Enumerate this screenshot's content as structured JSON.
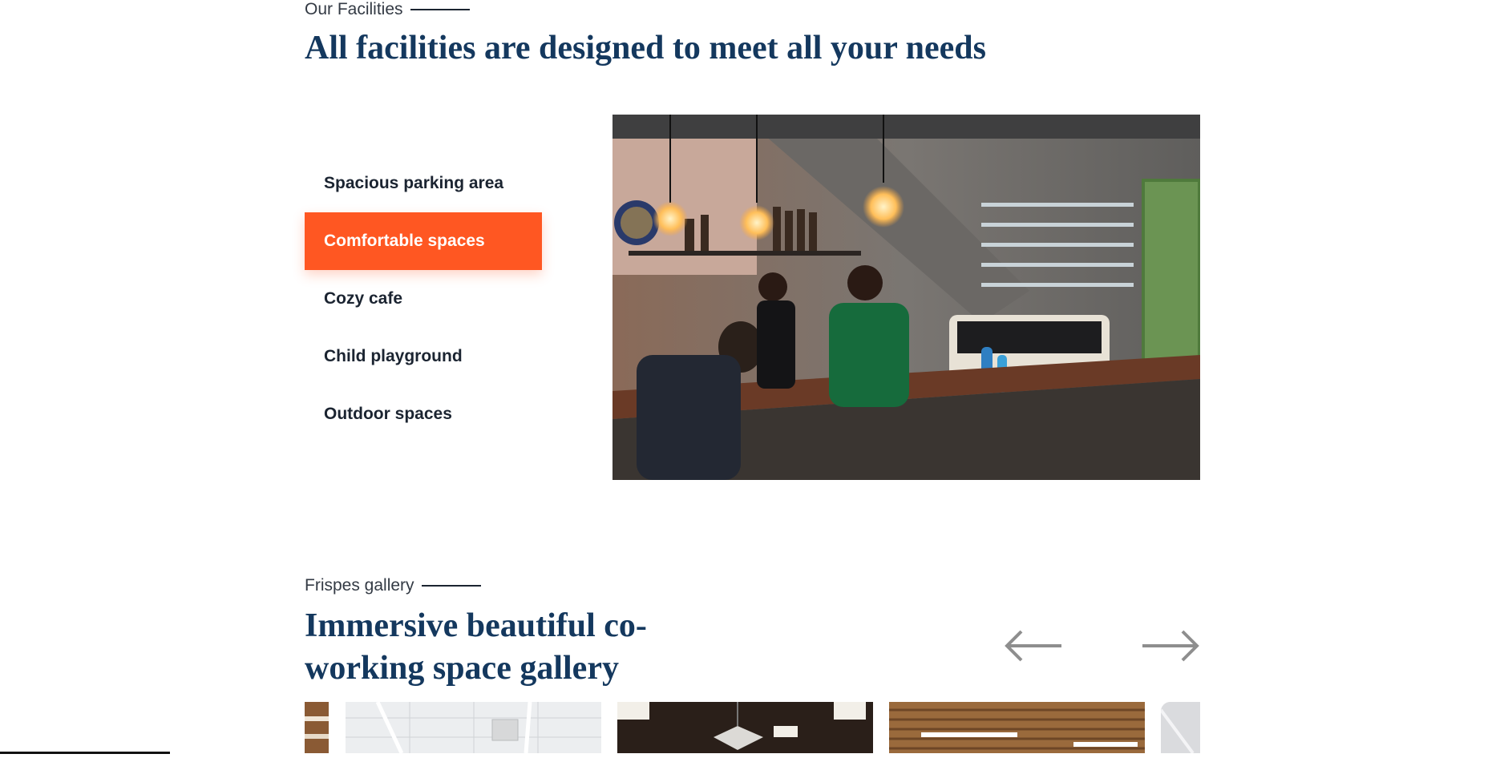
{
  "facilities": {
    "eyebrow": "Our Facilities",
    "heading": "All facilities are designed to meet all your needs",
    "items": [
      {
        "label": "Spacious parking area",
        "active": false
      },
      {
        "label": "Comfortable spaces",
        "active": true
      },
      {
        "label": "Cozy cafe",
        "active": false
      },
      {
        "label": "Child playground",
        "active": false
      },
      {
        "label": "Outdoor spaces",
        "active": false
      }
    ],
    "accent_color": "#ff5722",
    "heading_color": "#14385e"
  },
  "gallery": {
    "eyebrow": "Frispes gallery",
    "heading": "Immersive beautiful co-working space gallery",
    "prev_icon": "arrow-left-icon",
    "next_icon": "arrow-right-icon"
  }
}
